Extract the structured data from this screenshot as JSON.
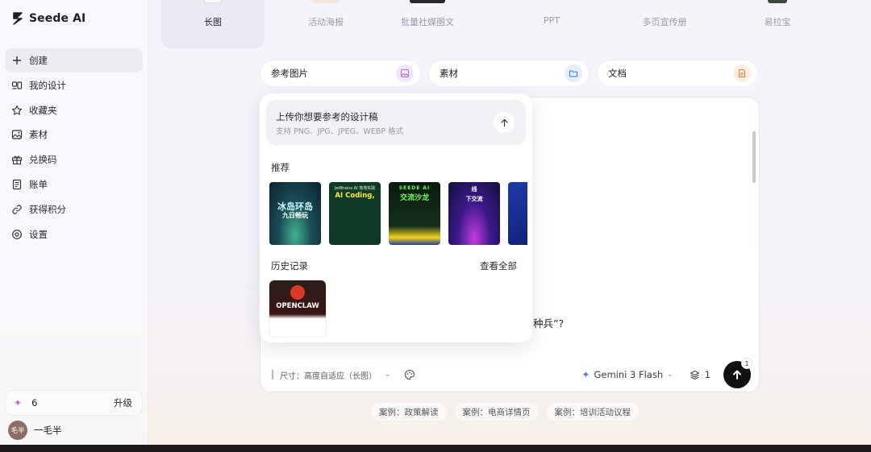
{
  "app": {
    "name": "Seede AI"
  },
  "sidebar": {
    "items": [
      {
        "label": "创建",
        "icon": "plus-icon",
        "active": true
      },
      {
        "label": "我的设计",
        "icon": "designs-icon"
      },
      {
        "label": "收藏夹",
        "icon": "star-icon"
      },
      {
        "label": "素材",
        "icon": "image-icon"
      },
      {
        "label": "兑换码",
        "icon": "gift-icon"
      },
      {
        "label": "账单",
        "icon": "bill-icon"
      },
      {
        "label": "获得积分",
        "icon": "link-icon"
      },
      {
        "label": "设置",
        "icon": "settings-icon"
      }
    ],
    "credits": {
      "count": "6",
      "upgrade": "升级"
    },
    "user": {
      "avatar_text": "毛半",
      "name": "一毛半"
    }
  },
  "tabs": [
    {
      "label": "长图",
      "active": true
    },
    {
      "label": "活动海报"
    },
    {
      "label": "批量社媒图文"
    },
    {
      "label": "PPT"
    },
    {
      "label": "多页宣传册"
    },
    {
      "label": "易拉宝"
    }
  ],
  "chips": {
    "reference": {
      "label": "参考图片",
      "icon": "image-icon",
      "color": "#f2e6fb"
    },
    "material": {
      "label": "素材",
      "icon": "folder-icon",
      "color": "#e3eefd"
    },
    "document": {
      "label": "文档",
      "icon": "document-icon",
      "color": "#fdeee0"
    }
  },
  "panel": {
    "upload_title": "上传你想要参考的设计稿",
    "upload_hint": "支持 PNG、JPG、JPEG、WEBP 格式",
    "recommend_title": "推荐",
    "history_title": "历史记录",
    "view_all": "查看全部",
    "recommendations": [
      {
        "line1": "冰岛环岛",
        "line2": "九日畅玩"
      },
      {
        "line1": "JetBrains AI 落地实践",
        "line2": "AI Coding,"
      },
      {
        "line1": "SEEDE AI",
        "line2": "交流沙龙"
      },
      {
        "line1": "线",
        "line2": "下交流"
      },
      {
        "line1": "",
        "line2": ""
      }
    ],
    "history": [
      {
        "label": "OPENCLAW"
      }
    ]
  },
  "editor": {
    "partial_text_1": "种兵”?",
    "size_label": "尺寸：高度自适应（长图）",
    "model": "Gemini 3 Flash",
    "layers_count": "1",
    "send_badge": "1"
  },
  "examples": [
    {
      "label": "案例：政策解读"
    },
    {
      "label": "案例：电商详情页"
    },
    {
      "label": "案例：培训活动议程"
    }
  ]
}
